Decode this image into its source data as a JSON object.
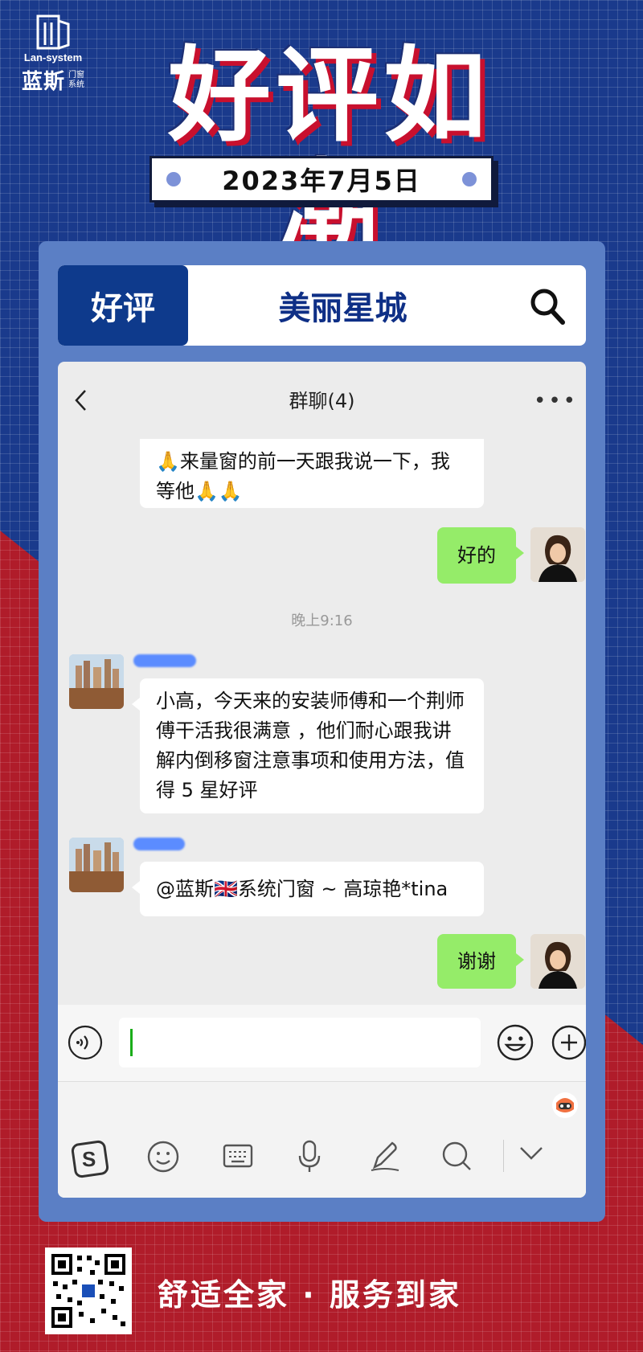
{
  "logo": {
    "en": "Lan-system",
    "cn_big": "蓝斯",
    "cn_small_1": "门窗",
    "cn_small_2": "系统"
  },
  "headline": "好评如潮",
  "date": "2023年7月5日",
  "searchbar": {
    "tag": "好评",
    "title": "美丽星城"
  },
  "chat": {
    "title": "群聊(4)",
    "messages": [
      {
        "text": "🙏来量窗的前一天跟我说一下，我等他🙏🙏"
      },
      {
        "text": "好的"
      },
      {
        "text": "晚上9:16"
      },
      {
        "text": "小高，今天来的安装师傅和一个荆师傅干活我很满意 ，他们耐心跟我讲解内倒移窗注意事项和使用方法，值得 5 星好评"
      },
      {
        "text": "@蓝斯🇬🇧系统门窗 ~ 高琼艳*tina"
      },
      {
        "text": "谢谢"
      }
    ]
  },
  "footer": {
    "slogan": "舒适全家 · 服务到家"
  },
  "colors": {
    "blue_bg": "#1a3a8c",
    "red_bg": "#b01c2a",
    "panel": "#5b7fc5",
    "tag_blue": "#0e3a8c",
    "bubble_green": "#95ec69"
  }
}
